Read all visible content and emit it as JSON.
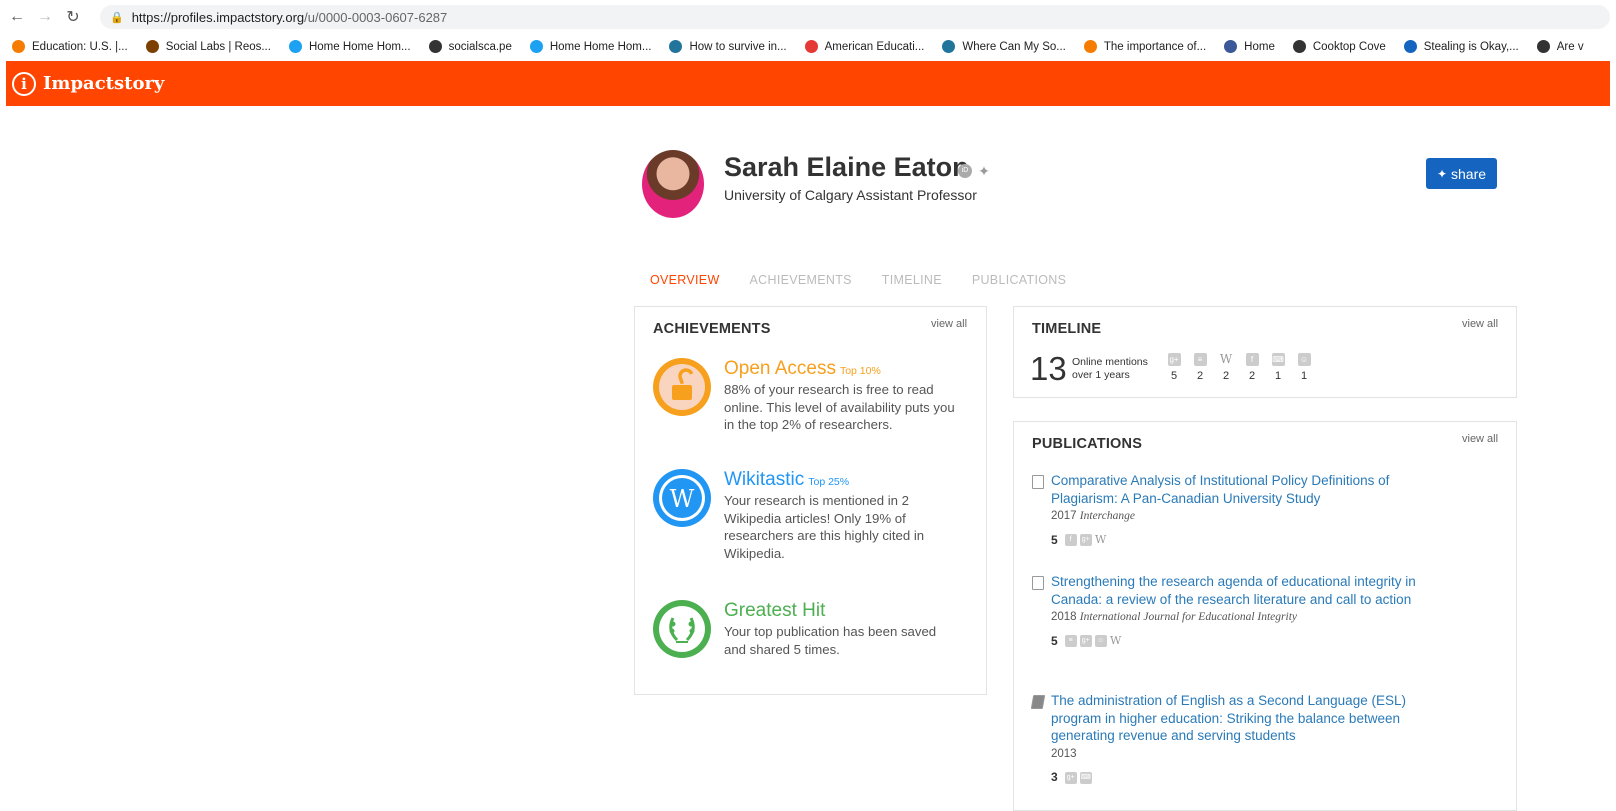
{
  "browser": {
    "url_host": "https://profiles.impactstory.org",
    "url_path": "/u/0000-0003-0607-6287",
    "bookmarks": [
      {
        "label": "Education: U.S. |...",
        "icon": "orange-dot-icon",
        "color": "#f57c00"
      },
      {
        "label": "Social Labs | Reos...",
        "icon": "diamond-icon",
        "color": "#7b3f00"
      },
      {
        "label": "Home Home Hom...",
        "icon": "twitter-icon",
        "color": "#1da1f2"
      },
      {
        "label": "socialsca.pe",
        "icon": "globe-icon",
        "color": "#333333"
      },
      {
        "label": "Home Home Hom...",
        "icon": "twitter-icon",
        "color": "#1da1f2"
      },
      {
        "label": "How to survive in...",
        "icon": "wordpress-icon",
        "color": "#21759b"
      },
      {
        "label": "American Educati...",
        "icon": "colorwheel-icon",
        "color": "#e53935"
      },
      {
        "label": "Where Can My So...",
        "icon": "wordpress-icon",
        "color": "#21759b"
      },
      {
        "label": "The importance of...",
        "icon": "ike-icon",
        "color": "#f57c00"
      },
      {
        "label": "Home",
        "icon": "facebook-icon",
        "color": "#3b5998"
      },
      {
        "label": "Cooktop Cove",
        "icon": "globe-icon",
        "color": "#333333"
      },
      {
        "label": "Stealing is Okay,...",
        "icon": "sparkle-icon",
        "color": "#1565c0"
      },
      {
        "label": "Are v",
        "icon": "so-icon",
        "color": "#333333"
      }
    ]
  },
  "app": {
    "name": "Impactstory",
    "accent": "#ff4500"
  },
  "profile": {
    "name": "Sarah Elaine Eaton",
    "affiliation": "University of Calgary Assistant Professor",
    "share_label": "share"
  },
  "tabs": [
    "OVERVIEW",
    "ACHIEVEMENTS",
    "TIMELINE",
    "PUBLICATIONS"
  ],
  "achievements": {
    "title": "ACHIEVEMENTS",
    "view_all": "view all",
    "items": [
      {
        "title": "Open Access",
        "top": "Top 10%",
        "color": "#f7a01e",
        "desc": "88% of your research is free to read online. This level of availability puts you in the top 2% of researchers."
      },
      {
        "title": "Wikitastic",
        "top": "Top 25%",
        "color": "#2196f3",
        "desc": "Your research is mentioned in 2 Wikipedia articles! Only 19% of researchers are this highly cited in Wikipedia."
      },
      {
        "title": "Greatest Hit",
        "top": "",
        "color": "#4caf50",
        "desc": "Your top publication has been saved and shared 5 times."
      }
    ]
  },
  "timeline": {
    "title": "TIMELINE",
    "view_all": "view all",
    "count": "13",
    "label_line1": "Online mentions",
    "label_line2": "over 1 years",
    "sources": [
      {
        "icon": "googleplus-icon",
        "glyph": "g+",
        "count": "5"
      },
      {
        "icon": "rss-icon",
        "glyph": "≡",
        "count": "2"
      },
      {
        "icon": "wikipedia-icon",
        "glyph": "W",
        "count": "2"
      },
      {
        "icon": "facebook-icon",
        "glyph": "f",
        "count": "2"
      },
      {
        "icon": "keyboard-icon",
        "glyph": "⌨",
        "count": "1"
      },
      {
        "icon": "reddit-icon",
        "glyph": "☺",
        "count": "1"
      }
    ]
  },
  "publications": {
    "title": "PUBLICATIONS",
    "view_all": "view all",
    "items": [
      {
        "title": "Comparative Analysis of Institutional Policy Definitions of Plagiarism: A Pan-Canadian University Study",
        "year": "2017",
        "venue": "Interchange",
        "score": "5",
        "icon": "document-icon",
        "metrics": [
          "f",
          "g+",
          "W"
        ]
      },
      {
        "title": "Strengthening the research agenda of educational integrity in Canada: a review of the research literature and call to action",
        "year": "2018",
        "venue": "International Journal for Educational Integrity",
        "score": "5",
        "icon": "document-icon",
        "metrics": [
          "≡",
          "g+",
          "☺",
          "W"
        ]
      },
      {
        "title": "The administration of English as a Second Language (ESL) program in higher education: Striking the balance between generating revenue and serving students",
        "year": "2013",
        "venue": "",
        "score": "3",
        "icon": "book-icon",
        "metrics": [
          "g+",
          "⌨"
        ]
      }
    ]
  }
}
